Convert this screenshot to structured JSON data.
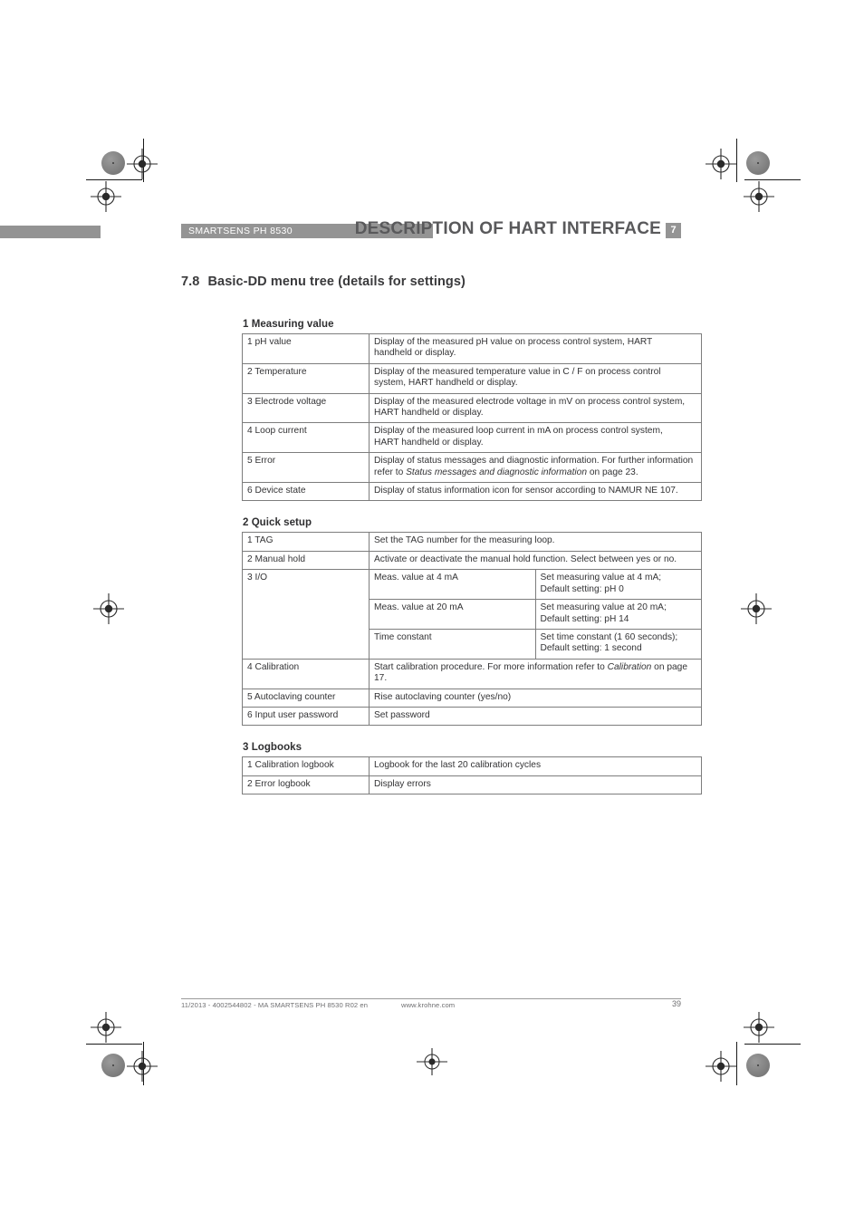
{
  "header": {
    "product_label": "SMARTSENS PH 8530",
    "title": "DESCRIPTION OF HART INTERFACE",
    "chapter_badge": "7",
    "bar_color": "#949494",
    "title_color": "#59595b"
  },
  "section": {
    "number": "7.8",
    "title": "Basic-DD menu tree (details for settings)"
  },
  "groups": [
    {
      "title": "1 Measuring value",
      "rows": [
        {
          "key": "1 pH value",
          "desc_lines": [
            "Display of the measured pH value on process control system, HART",
            "handheld or display."
          ]
        },
        {
          "key": "2 Temperature",
          "desc_lines": [
            "Display of the measured temperature value in  C /  F on process control",
            "system, HART   handheld or display."
          ]
        },
        {
          "key": "3 Electrode voltage",
          "desc_lines": [
            "Display of the measured electrode voltage in mV on process control system,",
            "HART   handheld or display."
          ]
        },
        {
          "key": "4 Loop current",
          "desc_lines": [
            "Display of the measured loop current in mA on process control system,",
            "HART   handheld or display."
          ]
        },
        {
          "key": "5 Error",
          "desc_pre": "Display of status messages and diagnostic information. For further information refer to ",
          "desc_italic": "Status messages and diagnostic information",
          "desc_post": " on page 23."
        },
        {
          "key": "6 Device state",
          "desc_lines": [
            "Display of status information icon for sensor according to NAMUR NE 107."
          ]
        }
      ]
    },
    {
      "title": "2 Quick setup",
      "rows": [
        {
          "key": "1 TAG",
          "desc_lines": [
            "Set the TAG number for the measuring loop."
          ]
        },
        {
          "key": "2 Manual hold",
          "desc_lines": [
            "Activate or deactivate the manual hold function. Select between yes or no."
          ]
        },
        {
          "key": "3 I/O",
          "subrows": [
            {
              "sub": "Meas. value at 4 mA",
              "value_lines": [
                "Set measuring value at 4 mA;",
                "Default setting: pH 0"
              ]
            },
            {
              "sub": "Meas. value at 20 mA",
              "value_lines": [
                "Set measuring value at 20 mA;",
                "Default setting: pH 14"
              ]
            },
            {
              "sub": "Time constant",
              "value_lines": [
                "Set time constant (1   60 seconds);",
                "Default setting: 1 second"
              ]
            }
          ]
        },
        {
          "key": "4 Calibration",
          "desc_pre": "Start calibration procedure. For more information refer to ",
          "desc_italic": "Calibration",
          "desc_post": " on page 17."
        },
        {
          "key": "5 Autoclaving counter",
          "desc_lines": [
            "Rise autoclaving counter (yes/no)"
          ]
        },
        {
          "key": "6 Input user password",
          "desc_lines": [
            "Set password"
          ]
        }
      ]
    },
    {
      "title": "3 Logbooks",
      "rows": [
        {
          "key": "1 Calibration logbook",
          "desc_lines": [
            "Logbook for the last 20 calibration cycles"
          ]
        },
        {
          "key": "2 Error logbook",
          "desc_lines": [
            "Display errors"
          ]
        }
      ]
    }
  ],
  "footer": {
    "left": "11/2013 - 4002544802 - MA SMARTSENS PH 8530 R02 en",
    "center": "www.krohne.com",
    "page": "39"
  }
}
